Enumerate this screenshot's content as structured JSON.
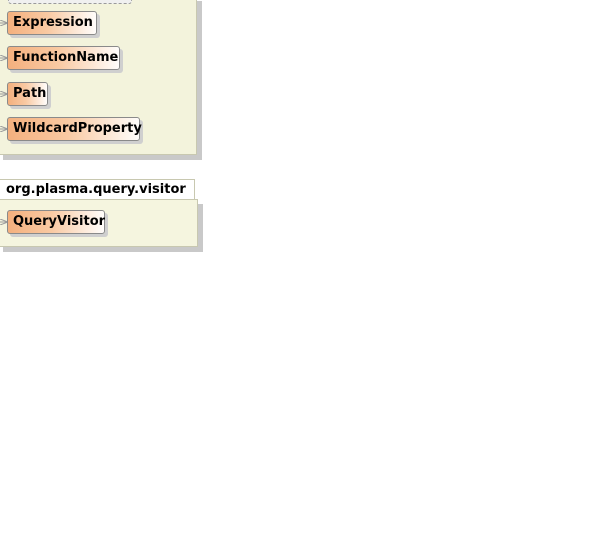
{
  "packages": [
    {
      "name": "",
      "classes": [
        {
          "name": "Expression"
        },
        {
          "name": "FunctionName"
        },
        {
          "name": "Path"
        },
        {
          "name": "WildcardProperty"
        }
      ]
    },
    {
      "name": "org.plasma.query.visitor",
      "classes": [
        {
          "name": "QueryVisitor"
        }
      ]
    }
  ],
  "colors": {
    "package_fill": "#f5f5dc",
    "class_gradient_start": "#f4b07e",
    "class_gradient_end": "#fffdfb",
    "border": "#8a8a8a"
  }
}
